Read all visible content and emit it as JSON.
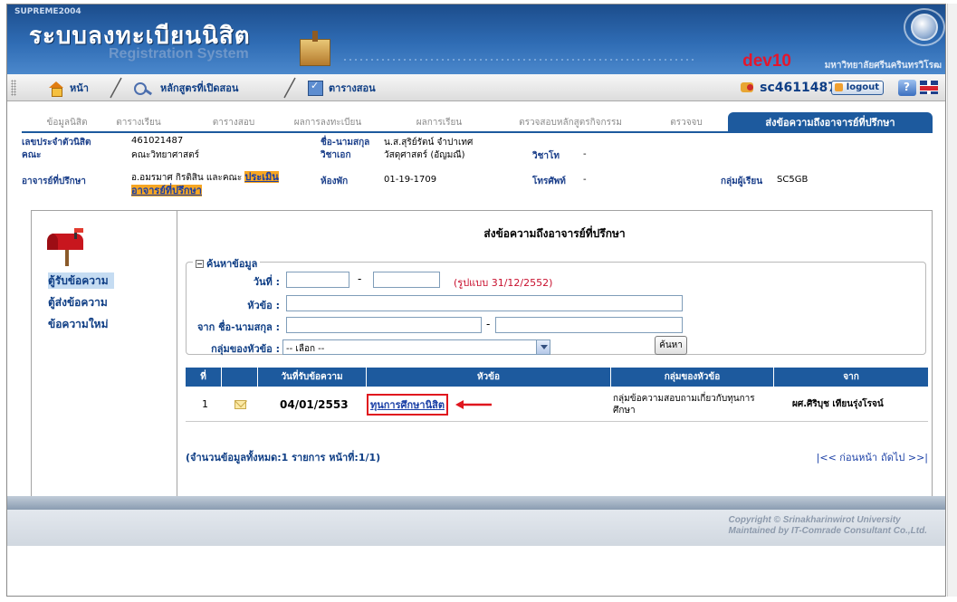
{
  "banner": {
    "brand": "SUPREME2004",
    "title": "ระบบลงทะเบียนนิสิต",
    "subtitle": "Registration System",
    "server": "dev10",
    "university": "มหาวิทยาลัยศรีนครินทรวิโรฒ"
  },
  "nav": {
    "home": "หน้า",
    "courses": "หลักสูตรที่เปิดสอน",
    "schedule": "ตารางสอน",
    "user_id": "sc4611487",
    "logout": "logout"
  },
  "tabs": [
    {
      "label": "ข้อมูลนิสิต"
    },
    {
      "label": "ตารางเรียน"
    },
    {
      "label": "ตารางสอบ"
    },
    {
      "label": "ผลการลงทะเบียน"
    },
    {
      "label": "ผลการเรียน"
    },
    {
      "label": "ตรวจสอบหลักสูตรกิจกรรม"
    },
    {
      "label": "ตรวจจบ"
    },
    {
      "label": "ส่งข้อความถึงอาจารย์ที่ปรึกษา"
    }
  ],
  "student": {
    "id_label": "เลขประจำตัวนิสิต",
    "id_value": "461021487",
    "faculty_label": "คณะ",
    "faculty_value": "คณะวิทยาศาสตร์",
    "advisor_label": "อาจารย์ที่ปรึกษา",
    "advisor_value": "อ.อมรมาศ กิรติสิน และคณะ",
    "evaluate_link": "ประเมินอาจารย์ที่ปรึกษา",
    "name_label": "ชื่อ-นามสกุล",
    "name_value": "น.ส.สุริย์รัตน์ จำปาเทศ",
    "major_label": "วิชาเอก",
    "major_value": "วัสดุศาสตร์ (อัญมณี)",
    "room_label": "ห้องพัก",
    "room_value": "01-19-1709",
    "minor_label": "วิชาโท",
    "minor_value": "-",
    "phone_label": "โทรศัพท์",
    "phone_value": "-",
    "group_label": "กลุ่มผู้เรียน",
    "group_value": "SC5GB"
  },
  "sidebar": {
    "items": [
      {
        "label": "ตู้รับข้อความ"
      },
      {
        "label": "ตู้ส่งข้อความ"
      },
      {
        "label": "ข้อความใหม่"
      }
    ]
  },
  "page": {
    "title": "ส่งข้อความถึงอาจารย์ที่ปรึกษา"
  },
  "search": {
    "legend": "ค้นหาข้อมูล",
    "date_label": "วันที่ :",
    "date_hint": "(รูปแบบ 31/12/2552)",
    "subject_label": "หัวข้อ :",
    "from_label": "จาก ชื่อ-นามสกุล :",
    "group_label": "กลุ่มของหัวข้อ :",
    "group_selected": "-- เลือก --",
    "button": "ค้นหา"
  },
  "table": {
    "headers": [
      "ที่",
      "",
      "วันที่รับข้อความ",
      "หัวข้อ",
      "กลุ่มของหัวข้อ",
      "จาก"
    ],
    "rows": [
      {
        "no": "1",
        "date": "04/01/2553",
        "subject": "ทุนการศึกษานิสิต",
        "group": "กลุ่มข้อความสอบถามเกี่ยวกับทุนการศึกษา",
        "from": "ผศ.ศิริบุช เทียนรุ่งโรจน์"
      }
    ],
    "record_count": "(จำนวนข้อมูลทั้งหมด:1 รายการ หน้าที่:1/1)",
    "pager": {
      "prev": "|<< ก่อนหน้า",
      "next": "ถัดไป >>|"
    }
  },
  "footer": {
    "line1": "Copyright © Srinakharinwirot University",
    "line2": "Maintained by IT-Comrade Consultant Co.,Ltd."
  },
  "colors": {
    "header_blue": "#1d5a9e",
    "link_blue": "#0f3e85",
    "highlight_orange": "#f6a623",
    "annotation_red": "#e0161e"
  }
}
